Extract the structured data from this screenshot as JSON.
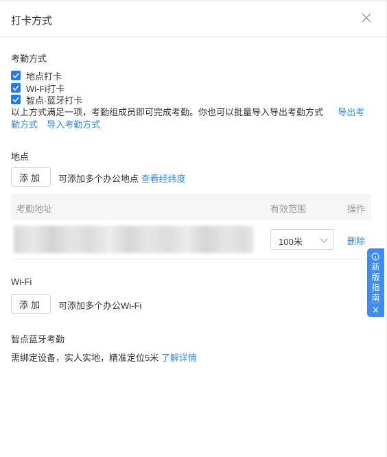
{
  "header": {
    "title": "打卡方式"
  },
  "attendance": {
    "section_title": "考勤方式",
    "options": [
      {
        "label": "地点打卡",
        "checked": true
      },
      {
        "label": "Wi-Fi打卡",
        "checked": true
      },
      {
        "label": "智点·蓝牙打卡",
        "checked": true
      }
    ],
    "description": "以上方式满足一项，考勤组成员即可完成考勤。你也可以批量导入导出考勤方式",
    "export_link": "导出考勤方式",
    "import_link": "导入考勤方式"
  },
  "location": {
    "section_title": "地点",
    "add_button": "添加",
    "hint": "可添加多个办公地点",
    "coords_link": "查看经纬度",
    "table": {
      "col_address": "考勤地址",
      "col_range": "有效范围",
      "col_action": "操作",
      "rows": [
        {
          "address": "",
          "range": "100米",
          "action": "删除"
        }
      ]
    }
  },
  "wifi": {
    "section_title": "Wi-Fi",
    "add_button": "添加",
    "hint": "可添加多个办公Wi-Fi"
  },
  "bluetooth": {
    "section_title": "智点蓝牙考勤",
    "description": "需绑定设备，实人实地，精准定位5米",
    "details_link": "了解详情"
  },
  "guide": {
    "label": "新版指南"
  },
  "colors": {
    "accent": "#2d8cf0",
    "checkbox": "#1e7bf3",
    "guide_bg": "#3d8bf5"
  },
  "icons": [
    "close-icon",
    "checkbox-checked-icon",
    "chevron-down-icon",
    "info-icon",
    "guide-close-icon"
  ]
}
